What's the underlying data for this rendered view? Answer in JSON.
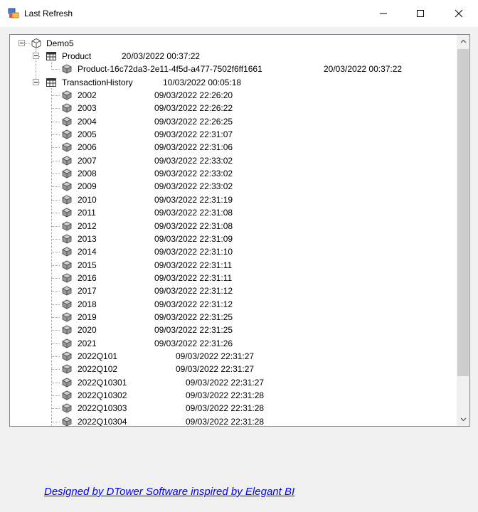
{
  "window": {
    "title": "Last Refresh",
    "minimize_icon": "minimize-icon",
    "maximize_icon": "maximize-icon",
    "close_icon": "close-icon"
  },
  "tree": {
    "root": {
      "label": "Demo5",
      "icon": "cube-outline-icon"
    },
    "product": {
      "label": "Product",
      "time": "20/03/2022 00:37:22",
      "icon": "table-icon",
      "children": [
        {
          "label": "Product-16c72da3-2e11-4f5d-a477-7502f6ff1661",
          "time": "20/03/2022 00:37:22",
          "icon": "partition-icon"
        }
      ]
    },
    "transaction_history": {
      "label": "TransactionHistory",
      "time": "10/03/2022 00:05:18",
      "icon": "table-icon",
      "children": [
        {
          "label": "2002",
          "time": "09/03/2022 22:26:20"
        },
        {
          "label": "2003",
          "time": "09/03/2022 22:26:22"
        },
        {
          "label": "2004",
          "time": "09/03/2022 22:26:25"
        },
        {
          "label": "2005",
          "time": "09/03/2022 22:31:07"
        },
        {
          "label": "2006",
          "time": "09/03/2022 22:31:06"
        },
        {
          "label": "2007",
          "time": "09/03/2022 22:33:02"
        },
        {
          "label": "2008",
          "time": "09/03/2022 22:33:02"
        },
        {
          "label": "2009",
          "time": "09/03/2022 22:33:02"
        },
        {
          "label": "2010",
          "time": "09/03/2022 22:31:19"
        },
        {
          "label": "2011",
          "time": "09/03/2022 22:31:08"
        },
        {
          "label": "2012",
          "time": "09/03/2022 22:31:08"
        },
        {
          "label": "2013",
          "time": "09/03/2022 22:31:09"
        },
        {
          "label": "2014",
          "time": "09/03/2022 22:31:10"
        },
        {
          "label": "2015",
          "time": "09/03/2022 22:31:11"
        },
        {
          "label": "2016",
          "time": "09/03/2022 22:31:11"
        },
        {
          "label": "2017",
          "time": "09/03/2022 22:31:12"
        },
        {
          "label": "2018",
          "time": "09/03/2022 22:31:12"
        },
        {
          "label": "2019",
          "time": "09/03/2022 22:31:25"
        },
        {
          "label": "2020",
          "time": "09/03/2022 22:31:25"
        },
        {
          "label": "2021",
          "time": "09/03/2022 22:31:26"
        },
        {
          "label": "2022Q101",
          "time": "09/03/2022 22:31:27"
        },
        {
          "label": "2022Q102",
          "time": "09/03/2022 22:31:27"
        },
        {
          "label": "2022Q10301",
          "time": "09/03/2022 22:31:27"
        },
        {
          "label": "2022Q10302",
          "time": "09/03/2022 22:31:28"
        },
        {
          "label": "2022Q10303",
          "time": "09/03/2022 22:31:28"
        },
        {
          "label": "2022Q10304",
          "time": "09/03/2022 22:31:28"
        }
      ]
    },
    "partition_icon": "partition-icon"
  },
  "scrollbar": {
    "up_icon": "chevron-up-icon",
    "down_icon": "chevron-down-icon"
  },
  "footer": {
    "link_text": "Designed by DTower Software inspired by Elegant BI"
  }
}
